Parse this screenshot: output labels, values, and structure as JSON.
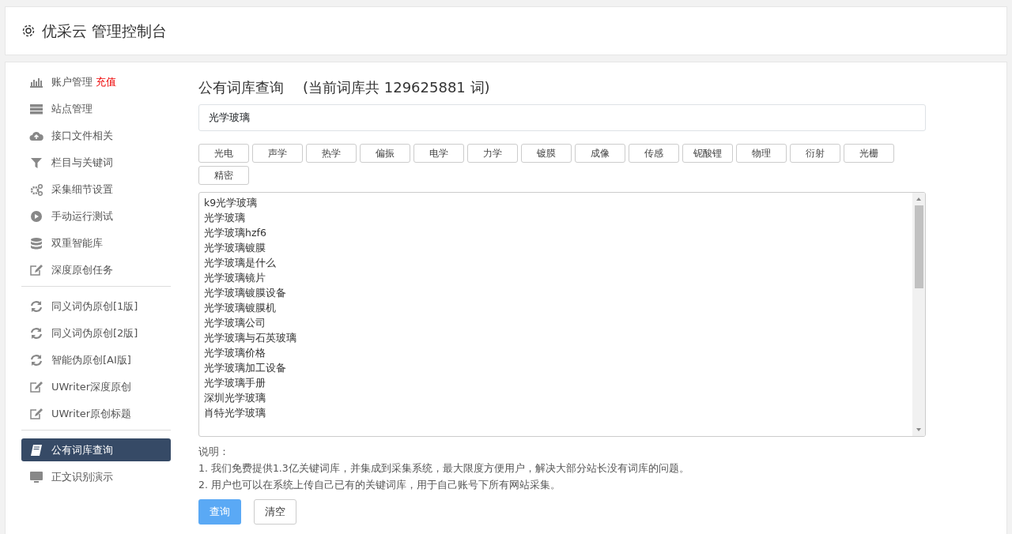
{
  "header": {
    "title": "优采云 管理控制台"
  },
  "sidebar": {
    "groups": [
      [
        {
          "label": "账户管理",
          "badge": "充值",
          "kind": "chart",
          "selected": false
        },
        {
          "label": "站点管理",
          "kind": "server",
          "selected": false
        },
        {
          "label": "接口文件相关",
          "kind": "cloud",
          "selected": false
        },
        {
          "label": "栏目与关键词",
          "kind": "filter",
          "selected": false
        },
        {
          "label": "采集细节设置",
          "kind": "gears",
          "selected": false
        },
        {
          "label": "手动运行测试",
          "kind": "play",
          "selected": false
        },
        {
          "label": "双重智能库",
          "kind": "database",
          "selected": false
        },
        {
          "label": "深度原创任务",
          "kind": "edit",
          "selected": false
        }
      ],
      [
        {
          "label": "同义词伪原创[1版]",
          "kind": "refresh",
          "selected": false
        },
        {
          "label": "同义词伪原创[2版]",
          "kind": "refresh",
          "selected": false
        },
        {
          "label": "智能伪原创[AI版]",
          "kind": "refresh",
          "selected": false
        },
        {
          "label": "UWriter深度原创",
          "kind": "edit",
          "selected": false
        },
        {
          "label": "UWriter原创标题",
          "kind": "edit",
          "selected": false
        }
      ],
      [
        {
          "label": "公有词库查询",
          "kind": "book",
          "selected": true
        },
        {
          "label": "正文识别演示",
          "kind": "monitor",
          "selected": false
        }
      ]
    ]
  },
  "main": {
    "title": "公有词库查询",
    "subtitle": "(当前词库共 129625881 词)",
    "search": {
      "value": "光学玻璃"
    },
    "tags": [
      "光电",
      "声学",
      "热学",
      "偏振",
      "电学",
      "力学",
      "镀膜",
      "成像",
      "传感",
      "铌酸锂",
      "物理",
      "衍射",
      "光栅",
      "精密"
    ],
    "results": [
      "k9光学玻璃",
      "光学玻璃",
      "光学玻璃hzf6",
      "光学玻璃镀膜",
      "光学玻璃是什么",
      "光学玻璃镜片",
      "光学玻璃镀膜设备",
      "光学玻璃镀膜机",
      "光学玻璃公司",
      "光学玻璃与石英玻璃",
      "光学玻璃价格",
      "光学玻璃加工设备",
      "光学玻璃手册",
      "深圳光学玻璃",
      "肖特光学玻璃"
    ],
    "notes_title": "说明：",
    "notes": [
      "1. 我们免费提供1.3亿关键词库，并集成到采集系统，最大限度方便用户，解决大部分站长没有词库的问题。",
      "2. 用户也可以在系统上传自己已有的关键词库，用于自己账号下所有网站采集。"
    ],
    "buttons": [
      {
        "label": "查询",
        "kind": "primary"
      },
      {
        "label": "清空",
        "kind": "secondary"
      }
    ]
  }
}
